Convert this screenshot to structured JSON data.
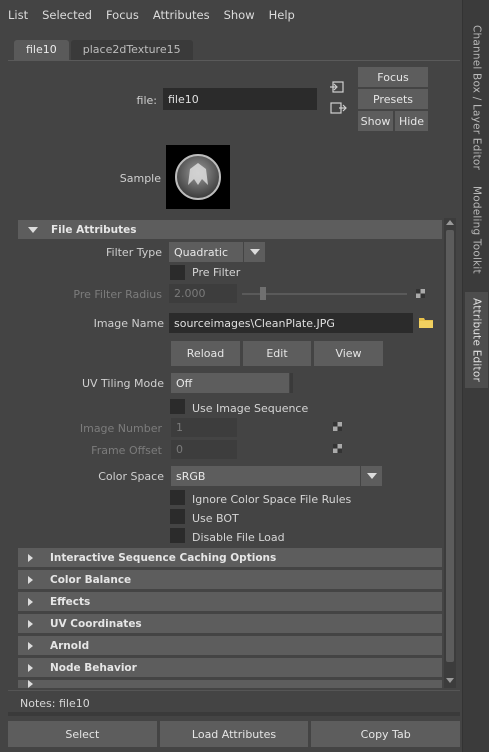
{
  "menu": [
    "List",
    "Selected",
    "Focus",
    "Attributes",
    "Show",
    "Help"
  ],
  "side_tabs": {
    "channel_box": "Channel Box / Layer Editor",
    "modeling_toolkit": "Modeling Toolkit",
    "attribute_editor": "Attribute Editor"
  },
  "node_tabs": [
    "file10",
    "place2dTexture15"
  ],
  "header": {
    "file_label": "file:",
    "file_value": "file10",
    "focus_label": "Focus",
    "presets_label": "Presets",
    "show_label": "Show",
    "hide_label": "Hide",
    "sample_label": "Sample"
  },
  "file_attributes": {
    "title": "File Attributes",
    "filter_type_label": "Filter Type",
    "filter_type_value": "Quadratic",
    "pre_filter_label": "Pre Filter",
    "pre_filter_radius_label": "Pre Filter Radius",
    "pre_filter_radius_value": "2.000",
    "image_name_label": "Image Name",
    "image_name_value": "sourceimages\\CleanPlate.JPG",
    "reload_label": "Reload",
    "edit_label": "Edit",
    "view_label": "View",
    "uv_tiling_mode_label": "UV Tiling Mode",
    "uv_tiling_mode_value": "Off",
    "use_image_sequence_label": "Use Image Sequence",
    "image_number_label": "Image Number",
    "image_number_value": "1",
    "frame_offset_label": "Frame Offset",
    "frame_offset_value": "0",
    "color_space_label": "Color Space",
    "color_space_value": "sRGB",
    "ignore_cs_rules_label": "Ignore Color Space File Rules",
    "use_bot_label": "Use BOT",
    "disable_file_load_label": "Disable File Load"
  },
  "collapsed_sections": [
    "Interactive Sequence Caching Options",
    "Color Balance",
    "Effects",
    "UV Coordinates",
    "Arnold",
    "Node Behavior"
  ],
  "notes": "Notes:  file10",
  "bottom_buttons": [
    "Select",
    "Load Attributes",
    "Copy Tab"
  ],
  "colors": {
    "panel_bg": "#444444",
    "field_bg": "#2b2b2b",
    "button_bg": "#5d5d5d",
    "folder_icon": "#e8c14a"
  }
}
